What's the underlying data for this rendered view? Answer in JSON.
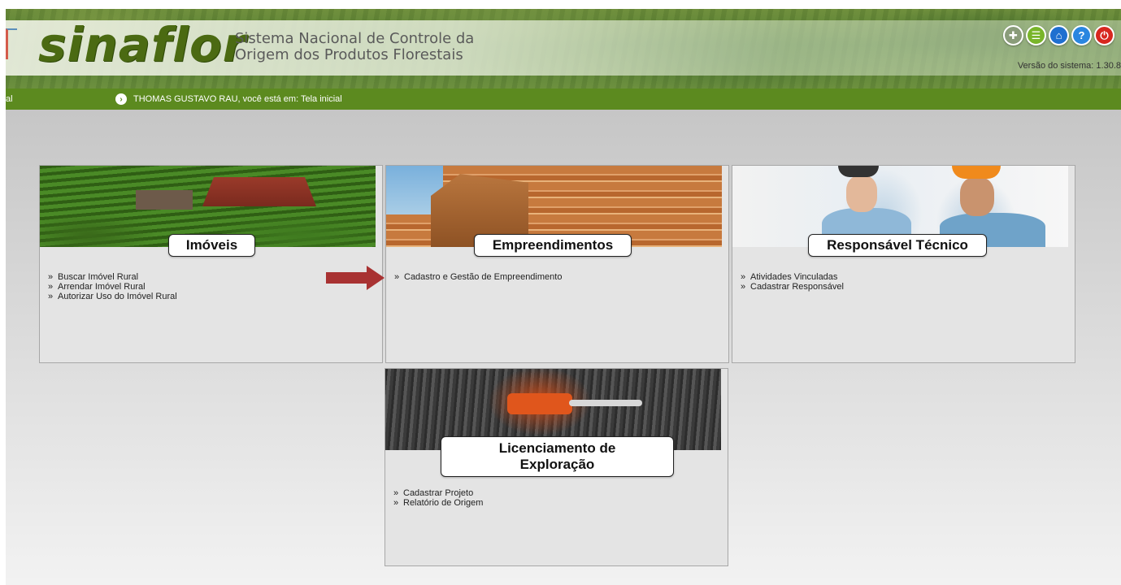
{
  "header": {
    "logo_text": "sinaflor",
    "tagline_line1": "Sistema Nacional de Controle da",
    "tagline_line2": "Origem dos Produtos Florestais",
    "version": "Versão do sistema: 1.30.8",
    "icons": [
      "plus-leaf-icon",
      "list-icon",
      "home-icon",
      "help-icon",
      "power-icon"
    ],
    "icon_glyphs": {
      "plus": "✚",
      "list": "☰",
      "home": "⌂",
      "help": "?",
      "power": "⏻"
    }
  },
  "navbar": {
    "crumb": "al",
    "user_text": "THOMAS GUSTAVO RAU, você está em: Tela inicial",
    "arrow_glyph": "›"
  },
  "cards": {
    "imoveis": {
      "title": "Imóveis",
      "links": [
        "Buscar Imóvel Rural",
        "Arrendar Imóvel Rural",
        "Autorizar Uso do Imóvel Rural"
      ]
    },
    "empreendimentos": {
      "title": "Empreendimentos",
      "links": [
        "Cadastro e Gestão de Empreendimento"
      ]
    },
    "responsavel": {
      "title": "Responsável Técnico",
      "links": [
        "Atividades Vinculadas",
        "Cadastrar Responsável"
      ]
    },
    "licenciamento": {
      "title_line1": "Licenciamento de",
      "title_line2": "Exploração",
      "links": [
        "Cadastrar Projeto",
        "Relatório de Origem"
      ]
    }
  },
  "bullet": "»",
  "colors": {
    "nav_green": "#5c8a1f",
    "arrow_red": "#a83232",
    "logo_green": "#4b6a12"
  }
}
